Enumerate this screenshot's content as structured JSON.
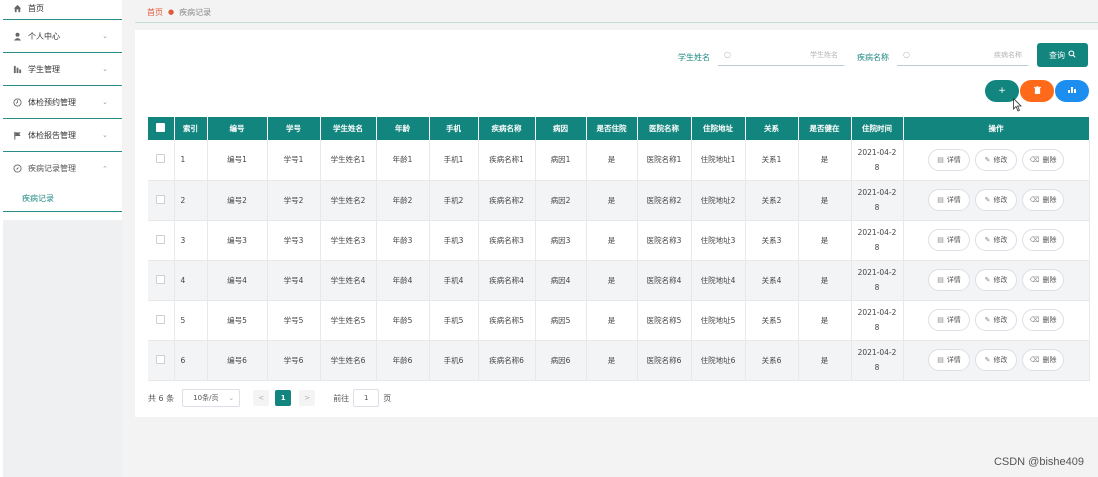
{
  "sidebar": {
    "items": [
      {
        "label": "首页",
        "icon": "home-icon"
      },
      {
        "label": "个人中心",
        "icon": "user-icon"
      },
      {
        "label": "学生管理",
        "icon": "bar-icon"
      },
      {
        "label": "体检预约管理",
        "icon": "clock-icon"
      },
      {
        "label": "体检报告管理",
        "icon": "flag-icon"
      },
      {
        "label": "疾病记录管理",
        "icon": "compass-icon"
      }
    ],
    "submenu": "疾病记录"
  },
  "breadcrumb": {
    "home": "首页",
    "current": "疾病记录"
  },
  "search": {
    "student_label": "学生姓名",
    "student_placeholder": "学生姓名",
    "disease_label": "疾病名称",
    "disease_placeholder": "疾病名称",
    "query_label": "查询"
  },
  "actions": {
    "add": "+",
    "delete": "🗑",
    "stat": "▟"
  },
  "table": {
    "headers": [
      "索引",
      "编号",
      "学号",
      "学生姓名",
      "年龄",
      "手机",
      "疾病名称",
      "病因",
      "是否住院",
      "医院名称",
      "住院地址",
      "关系",
      "是否健在",
      "住院时间",
      "操作"
    ],
    "rows": [
      {
        "idx": "1",
        "no": "编号1",
        "sid": "学号1",
        "name": "学生姓名1",
        "age": "年龄1",
        "phone": "手机1",
        "disease": "疾病名称1",
        "cause": "病因1",
        "hosp": "是",
        "hospital": "医院名称1",
        "addr": "住院地址1",
        "rel": "关系1",
        "alive": "是",
        "date": "2021-04-28"
      },
      {
        "idx": "2",
        "no": "编号2",
        "sid": "学号2",
        "name": "学生姓名2",
        "age": "年龄2",
        "phone": "手机2",
        "disease": "疾病名称2",
        "cause": "病因2",
        "hosp": "是",
        "hospital": "医院名称2",
        "addr": "住院地址2",
        "rel": "关系2",
        "alive": "是",
        "date": "2021-04-28"
      },
      {
        "idx": "3",
        "no": "编号3",
        "sid": "学号3",
        "name": "学生姓名3",
        "age": "年龄3",
        "phone": "手机3",
        "disease": "疾病名称3",
        "cause": "病因3",
        "hosp": "是",
        "hospital": "医院名称3",
        "addr": "住院地址3",
        "rel": "关系3",
        "alive": "是",
        "date": "2021-04-28"
      },
      {
        "idx": "4",
        "no": "编号4",
        "sid": "学号4",
        "name": "学生姓名4",
        "age": "年龄4",
        "phone": "手机4",
        "disease": "疾病名称4",
        "cause": "病因4",
        "hosp": "是",
        "hospital": "医院名称4",
        "addr": "住院地址4",
        "rel": "关系4",
        "alive": "是",
        "date": "2021-04-28"
      },
      {
        "idx": "5",
        "no": "编号5",
        "sid": "学号5",
        "name": "学生姓名5",
        "age": "年龄5",
        "phone": "手机5",
        "disease": "疾病名称5",
        "cause": "病因5",
        "hosp": "是",
        "hospital": "医院名称5",
        "addr": "住院地址5",
        "rel": "关系5",
        "alive": "是",
        "date": "2021-04-28"
      },
      {
        "idx": "6",
        "no": "编号6",
        "sid": "学号6",
        "name": "学生姓名6",
        "age": "年龄6",
        "phone": "手机6",
        "disease": "疾病名称6",
        "cause": "病因6",
        "hosp": "是",
        "hospital": "医院名称6",
        "addr": "住院地址6",
        "rel": "关系6",
        "alive": "是",
        "date": "2021-04-28"
      }
    ],
    "op_labels": {
      "detail": "详情",
      "edit": "修改",
      "delete": "删除"
    }
  },
  "pager": {
    "total": "共 6 条",
    "size": "10条/页",
    "current": "1",
    "goto_prefix": "前往",
    "goto_value": "1",
    "goto_suffix": "页"
  },
  "watermark": "CSDN @bishe409",
  "colors": {
    "primary": "#12857e",
    "danger": "#ff6a1a",
    "info": "#1b8ef0",
    "breadcrumb_home": "#e05a3a"
  }
}
